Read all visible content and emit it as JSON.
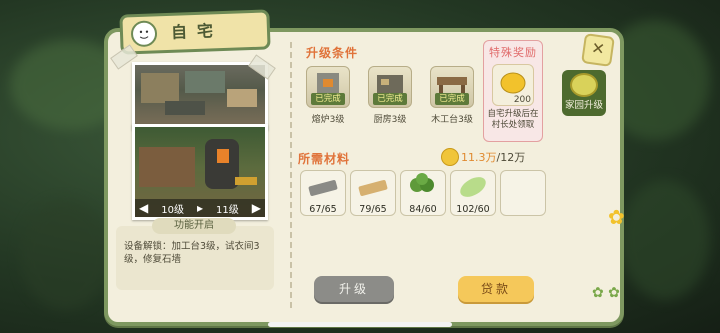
{
  "title": "自宅",
  "photo": {
    "level_current": "10级",
    "level_next": "11级"
  },
  "func": {
    "title": "功能开启",
    "text": "设备解锁：加工台3级，试衣间3级，修复石墙"
  },
  "conditions": {
    "label": "升级条件",
    "items": [
      {
        "name": "熔炉3级",
        "status": "已完成"
      },
      {
        "name": "厨房3级",
        "status": "已完成"
      },
      {
        "name": "木工台3级",
        "status": "已完成"
      }
    ]
  },
  "special": {
    "title": "特殊奖励",
    "count": "200",
    "desc": "自宅升级后在村长处领取"
  },
  "materials": {
    "label": "所需材料",
    "money_current": "11.3万",
    "money_required": "/12万",
    "items": [
      {
        "icon": "metal-ingot-icon",
        "count": "67/65"
      },
      {
        "icon": "wood-plank-icon",
        "count": "79/65"
      },
      {
        "icon": "broccoli-icon",
        "count": "84/60"
      },
      {
        "icon": "cabbage-icon",
        "count": "102/60"
      },
      {
        "icon": "empty-slot",
        "count": ""
      }
    ]
  },
  "buttons": {
    "upgrade": "升级",
    "loan": "贷款"
  },
  "side": {
    "home_upgrade": "家园升级"
  },
  "colors": {
    "accent_orange": "#e0733a",
    "panel_border": "#7e9860",
    "done_badge": "#5d7a3a"
  }
}
